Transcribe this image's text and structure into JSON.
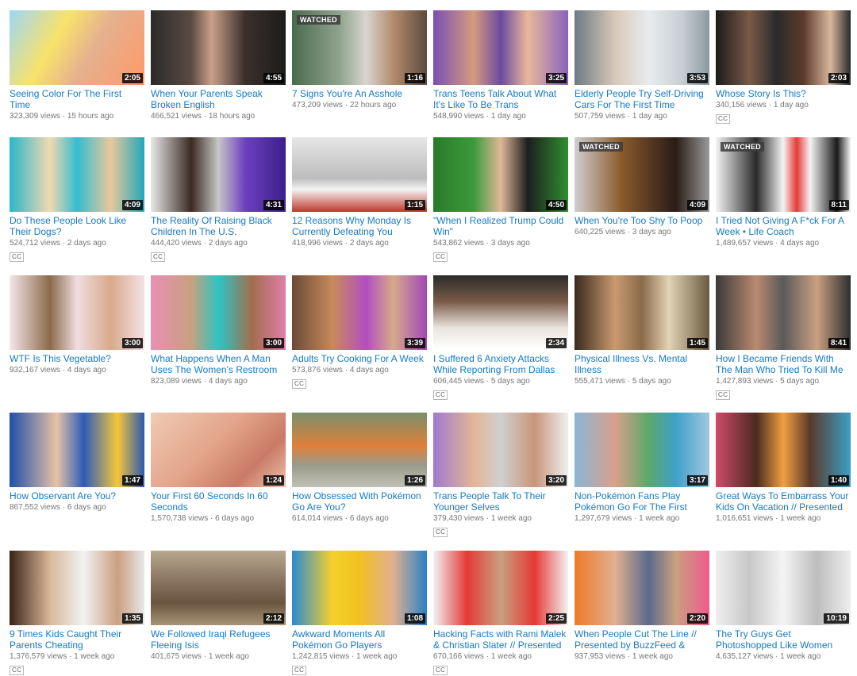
{
  "ui": {
    "watched_label": "WATCHED",
    "cc_label": "CC"
  },
  "videos": [
    {
      "title": "Seeing Color For The First Time",
      "views": "323,309 views",
      "age": "15 hours ago",
      "duration": "2:05",
      "watched": false,
      "cc": false,
      "bg": "linear-gradient(120deg,#9ed6f5 0%,#f8e36a 35%,#e5b08f 60%,#ff9966 100%)"
    },
    {
      "title": "When Your Parents Speak Broken English",
      "views": "466,521 views",
      "age": "18 hours ago",
      "duration": "4:55",
      "watched": false,
      "cc": false,
      "bg": "linear-gradient(90deg,#2b2b2b 0%,#5a4a42 30%,#c9a08a 45%,#3a2f2b 70%,#1c1c1c 100%)"
    },
    {
      "title": "7 Signs You're An Asshole",
      "views": "473,209 views",
      "age": "22 hours ago",
      "duration": "1:16",
      "watched": true,
      "cc": false,
      "bg": "linear-gradient(90deg,#4a6b4e 0%,#8fa38d 35%,#d8d5cf 55%,#b38b6d 75%,#5c4b3e 100%)"
    },
    {
      "title": "Trans Teens Talk About What It's Like To Be Trans",
      "views": "548,990 views",
      "age": "1 day ago",
      "duration": "3:25",
      "watched": false,
      "cc": false,
      "bg": "linear-gradient(90deg,#7a4fb3 0%,#d59b80 30%,#6b4aa0 50%,#e8b89a 70%,#8a62c0 100%)"
    },
    {
      "title": "Elderly People Try Self-Driving Cars For The First Time",
      "views": "507,759 views",
      "age": "1 day ago",
      "duration": "3:53",
      "watched": false,
      "cc": false,
      "bg": "linear-gradient(90deg,#6c7a84 0%,#d8c8b8 30%,#e9ecee 55%,#c7ced3 80%,#8c98a0 100%)"
    },
    {
      "title": "Whose Story Is This?",
      "views": "340,156 views",
      "age": "1 day ago",
      "duration": "2:03",
      "watched": false,
      "cc": true,
      "bg": "linear-gradient(90deg,#1b1b1b 0%,#7a5a48 25%,#2a2a2a 45%,#5b3b2c 65%,#d9b79d 85%,#2a2a2a 100%)"
    },
    {
      "title": "Do These People Look Like Their Dogs?",
      "views": "524,712 views",
      "age": "2 days ago",
      "duration": "4:09",
      "watched": false,
      "cc": true,
      "bg": "linear-gradient(90deg,#29b7c9 0%,#f2d9b0 30%,#35bcd0 50%,#e9c89b 75%,#20a8bb 100%)"
    },
    {
      "title": "The Reality Of Raising Black Children In The U.S.",
      "views": "444,420 views",
      "age": "2 days ago",
      "duration": "4:31",
      "watched": false,
      "cc": true,
      "bg": "linear-gradient(90deg,#e8e8e8 0%,#3a2a22 30%,#c7c7c7 50%,#6d3fbf 70%,#3d1f8a 100%)"
    },
    {
      "title": "12 Reasons Why Monday Is Currently Defeating You",
      "views": "418,996 views",
      "age": "2 days ago",
      "duration": "1:15",
      "watched": false,
      "cc": false,
      "bg": "linear-gradient(180deg,#e6e6e6 0%,#bdbdbd 55%,#f3f3f3 70%,#c0392b 100%)"
    },
    {
      "title": "\"When I Realized Trump Could Win\"",
      "views": "543,862 views",
      "age": "3 days ago",
      "duration": "4:50",
      "watched": false,
      "cc": true,
      "bg": "linear-gradient(90deg,#2a7a2a 0%,#3c9a3c 30%,#e0b896 50%,#1e1e1e 70%,#2f8f2f 100%)"
    },
    {
      "title": "When You're Too Shy To Poop",
      "views": "640,225 views",
      "age": "3 days ago",
      "duration": "4:09",
      "watched": true,
      "cc": false,
      "bg": "linear-gradient(90deg,#cfcfcf 0%,#8a5a2b 35%,#5a3a22 55%,#2a1c16 75%,#9a9a9a 100%)"
    },
    {
      "title": "I Tried Not Giving A F*ck For A Week • Life Coach",
      "views": "1,489,657 views",
      "age": "4 days ago",
      "duration": "8:11",
      "watched": true,
      "cc": false,
      "bg": "linear-gradient(90deg,#f4f4f4 0%,#2a2a2a 30%,#f4f4f4 50%,#e53935 60%,#f4f4f4 70%,#1a1a1a 90%,#f4f4f4 100%)"
    },
    {
      "title": "WTF Is This Vegetable?",
      "views": "932,167 views",
      "age": "4 days ago",
      "duration": "3:00",
      "watched": false,
      "cc": false,
      "bg": "linear-gradient(90deg,#f5e7ea 0%,#8b6a4a 30%,#f0dde1 50%,#d9a98a 75%,#f3e2e6 100%)"
    },
    {
      "title": "What Happens When A Man Uses The Women's Restroom",
      "views": "823,089 views",
      "age": "4 days ago",
      "duration": "3:00",
      "watched": false,
      "cc": false,
      "bg": "linear-gradient(90deg,#e98fb5 0%,#c9a07e 30%,#2ec4c4 50%,#a36d4e 75%,#e07fa8 100%)"
    },
    {
      "title": "Adults Try Cooking For A Week",
      "views": "573,876 views",
      "age": "4 days ago",
      "duration": "3:39",
      "watched": false,
      "cc": true,
      "bg": "linear-gradient(90deg,#6b4a38 0%,#c78a5a 30%,#b24fc0 55%,#d7a98a 75%,#a048b8 100%)"
    },
    {
      "title": "I Suffered 6 Anxiety Attacks While Reporting From Dallas",
      "views": "606,445 views",
      "age": "5 days ago",
      "duration": "2:34",
      "watched": false,
      "cc": true,
      "bg": "linear-gradient(180deg,#2b2b2b 0%,#7a5a48 35%,#e9e3dd 70%,#ffffff 100%)"
    },
    {
      "title": "Physical Illness Vs. Mental Illness",
      "views": "555,471 views",
      "age": "5 days ago",
      "duration": "1:45",
      "watched": false,
      "cc": false,
      "bg": "linear-gradient(90deg,#3a2a1c 0%,#c99a70 30%,#8a6a4a 50%,#e3d3b5 70%,#6a5a40 100%)"
    },
    {
      "title": "How I Became Friends With The Man Who Tried To Kill Me",
      "views": "1,427,893 views",
      "age": "5 days ago",
      "duration": "8:41",
      "watched": false,
      "cc": true,
      "bg": "linear-gradient(90deg,#3a3a3a 0%,#b98a70 30%,#5a5a5a 50%,#c9a080 75%,#2e2e2e 100%)"
    },
    {
      "title": "How Observant Are You?",
      "views": "867,552 views",
      "age": "6 days ago",
      "duration": "1:47",
      "watched": false,
      "cc": false,
      "bg": "linear-gradient(90deg,#1f4fa8 0%,#e7c2a6 35%,#2d5cb8 55%,#f6c63a 80%,#2a58b0 100%)"
    },
    {
      "title": "Your First 60 Seconds In 60 Seconds",
      "views": "1,570,738 views",
      "age": "6 days ago",
      "duration": "1:24",
      "watched": false,
      "cc": false,
      "bg": "linear-gradient(135deg,#f0cbb5 0%,#e3a48a 45%,#c97a66 75%,#eec3ab 100%)"
    },
    {
      "title": "How Obsessed With Pokémon Go Are You?",
      "views": "614,014 views",
      "age": "6 days ago",
      "duration": "1:26",
      "watched": false,
      "cc": false,
      "bg": "linear-gradient(180deg,#7a8f6a 0%,#e0803a 45%,#9a9a8a 70%,#c0c0b5 100%)"
    },
    {
      "title": "Trans People Talk To Their Younger Selves",
      "views": "379,430 views",
      "age": "1 week ago",
      "duration": "3:20",
      "watched": false,
      "cc": true,
      "bg": "linear-gradient(90deg,#a07ad0 0%,#e3b596 30%,#d0d0d0 50%,#c8957a 75%,#efefef 100%)"
    },
    {
      "title": "Non-Pokémon Fans Play Pokémon Go For The First Time",
      "views": "1,297,679 views",
      "age": "1 week ago",
      "duration": "3:17",
      "watched": false,
      "cc": false,
      "bg": "linear-gradient(90deg,#8ab6d6 0%,#d9a08a 30%,#5aa86a 55%,#3fa0c8 75%,#9fc8e2 100%)"
    },
    {
      "title": "Great Ways To Embarrass Your Kids On Vacation // Presented b...",
      "views": "1,016,651 views",
      "age": "1 week ago",
      "duration": "1:40",
      "watched": false,
      "cc": false,
      "bg": "linear-gradient(90deg,#d04a6a 0%,#4a2a20 30%,#f0a040 50%,#5a3a2a 70%,#3aa0c8 100%)"
    },
    {
      "title": "9 Times Kids Caught Their Parents Cheating",
      "views": "1,376,579 views",
      "age": "1 week ago",
      "duration": "1:35",
      "watched": false,
      "cc": true,
      "bg": "linear-gradient(90deg,#3a2218 0%,#d8b89a 30%,#f2f2f2 55%,#c9a080 80%,#e8e8e8 100%)"
    },
    {
      "title": "We Followed Iraqi Refugees Fleeing Isis",
      "views": "401,675 views",
      "age": "1 week ago",
      "duration": "2:12",
      "watched": false,
      "cc": false,
      "bg": "linear-gradient(180deg,#b8a890 0%,#8a7560 40%,#6a5540 70%,#a89478 100%)"
    },
    {
      "title": "Awkward Moments All Pokémon Go Players Understand",
      "views": "1,242,815 views",
      "age": "1 week ago",
      "duration": "1:08",
      "watched": false,
      "cc": true,
      "bg": "linear-gradient(90deg,#2a8ad0 0%,#f6d12a 30%,#f2c020 50%,#e0b090 75%,#2a80c8 100%)"
    },
    {
      "title": "Hacking Facts with Rami Malek & Christian Slater  // Presented by...",
      "views": "670,166 views",
      "age": "1 week ago",
      "duration": "2:25",
      "watched": false,
      "cc": true,
      "bg": "linear-gradient(90deg,#f2f2f2 0%,#e53935 25%,#c9a080 50%,#e53935 75%,#f2f2f2 100%)"
    },
    {
      "title": "When People Cut The Line // Presented by BuzzFeed & Dunki...",
      "views": "937,953 views",
      "age": "1 week ago",
      "duration": "2:20",
      "watched": false,
      "cc": false,
      "bg": "linear-gradient(90deg,#f07a2a 0%,#e0b090 30%,#5a6a8a 55%,#c9a080 75%,#ef5a8a 100%)"
    },
    {
      "title": "The Try Guys Get Photoshopped Like Women",
      "views": "4,635,127 views",
      "age": "1 week ago",
      "duration": "10:19",
      "watched": false,
      "cc": false,
      "bg": "linear-gradient(90deg,#eeeeee 0%,#c8c8c8 25%,#f4f4f4 50%,#bdbdbd 75%,#eeeeee 100%)"
    }
  ]
}
